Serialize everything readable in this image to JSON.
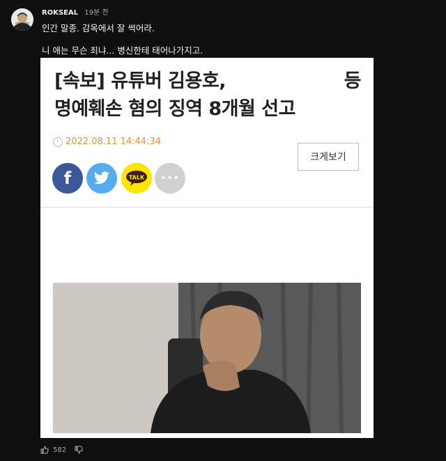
{
  "comment": {
    "author": "ROKSEAL",
    "time": "19분 전",
    "line1": "인간 말종. 감옥에서 잘 썩어라.",
    "line2": "니 애는 무슨 죄냐... 병신한테 태어나가지고.",
    "like_count": "582"
  },
  "article": {
    "headline_line1": "[속보] 유튜버 김용호,",
    "headline_line1_trailing": "등",
    "headline_line2": "명예훼손 혐의 징역 8개월 선고",
    "datetime": "2022.08.11 14:44:34",
    "enlarge_label": "크게보기",
    "kakao_label": "TALK",
    "facebook_glyph": "f",
    "more_glyph": "•••"
  },
  "colors": {
    "background": "#0f0f0f",
    "date": "#f0923a",
    "facebook": "#3b5998",
    "twitter": "#55acee",
    "kakao": "#fee500"
  },
  "icons": [
    "thumb-up-icon",
    "thumb-down-icon",
    "clock-icon",
    "facebook-icon",
    "twitter-icon",
    "kakao-talk-icon",
    "more-icon"
  ]
}
